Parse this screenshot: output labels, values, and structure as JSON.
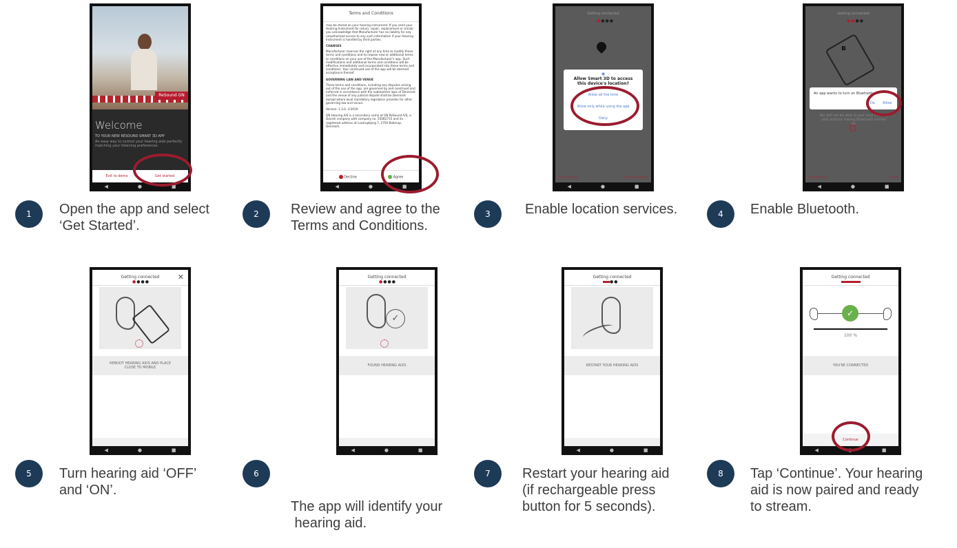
{
  "steps": [
    {
      "number": "1",
      "caption_lines": [
        "Open the app and select",
        "‘Get Started’."
      ]
    },
    {
      "number": "2",
      "caption_lines": [
        "Review and agree to the",
        "Terms and Conditions."
      ]
    },
    {
      "number": "3",
      "caption_lines": [
        "Enable location services."
      ]
    },
    {
      "number": "4",
      "caption_lines": [
        "Enable Bluetooth."
      ]
    },
    {
      "number": "5",
      "caption_lines": [
        "Turn hearing aid ‘OFF’",
        "and ‘ON’."
      ]
    },
    {
      "number": "6",
      "caption_lines": [
        "The app will identify your",
        " hearing aid."
      ]
    },
    {
      "number": "7",
      "caption_lines": [
        "Restart your hearing aid",
        "(if rechargeable press",
        "button for 5 seconds)."
      ]
    },
    {
      "number": "8",
      "caption_lines": [
        "Tap ‘Continue’. Your hearing",
        "aid is now paired and ready",
        "to stream."
      ]
    }
  ],
  "screen1": {
    "welcome": "Welcome",
    "brand": "ReSound GN",
    "subtitle": "TO YOUR NEW RESOUND SMART 3D APP",
    "description": "An easy way to control your hearing aids perfectly matching your listening preferences.",
    "exit_label": "Exit to demo",
    "start_label": "Get started"
  },
  "screen2": {
    "title": "Terms and Conditions",
    "para1": "may be stored on your hearing instrument. If you send your Hearing Instrument for return, repair, replacement or similar you acknowledge that Manufacturer has no liability for any unauthorized access to any such information if your Hearing Instrument is handled by third parties.",
    "heading_changes": "CHANGES",
    "para2": "Manufacturer reserves the right at any time to modify these terms and conditions and to impose new or additional terms or conditions on your use of the Manufacturer's app. Such modifications and additional terms and conditions will be effective immediately and incorporated into these terms and conditions. Your continued use of the app will be deemed acceptance thereof.",
    "heading_law": "GOVERNING LAW AND VENUE",
    "para3": "These terms and conditions, including any disputes arising out of the use of the app, are governed by and construed and enforced in accordance with the substantive laws of Denmark and the venue of any judicial dispute shall be Denmark except where local mandatory legislation provides for other governing law and venue.",
    "version": "Version: 1.3.0, ©2019",
    "para4": "GN Hearing A/S is a secondary name of GN ReSound A/S, a Danish company with company no. 55082715 and its registered address at Lautrupbjerg 7, 2750 Ballerup, Denmark.",
    "decline_label": "Decline",
    "agree_label": "Agree"
  },
  "screen3": {
    "header": "Getting connected",
    "question": "Allow Smart 3D to access this device's location?",
    "option1": "Allow all the time",
    "option2": "Allow only while using the app",
    "option3": "Deny",
    "bottom_left": "Exit pairing",
    "bottom_right": "Go to settings"
  },
  "screen4": {
    "header": "Getting connected",
    "prompt": "An app wants to turn on Bluetooth",
    "deny_label": "De",
    "allow_label": "Allow",
    "warning": "We will not be able to pair your hearing aids without having Bluetooth turned on",
    "bottom_left": "Exit pairing",
    "bottom_right": "Allow"
  },
  "screen5": {
    "header": "Getting connected",
    "message_line1": "REBOOT HEARING AIDS AND PLACE",
    "message_line2": "CLOSE TO MOBILE"
  },
  "screen6": {
    "header": "Getting connected",
    "message": "FOUND HEARING AIDS"
  },
  "screen7": {
    "header": "Getting connected",
    "message": "RESTART YOUR HEARING AIDS"
  },
  "screen8": {
    "header": "Getting connected",
    "percent": "100 %",
    "message": "YOU'RE CONNECTED",
    "continue_label": "Continue"
  },
  "colors": {
    "badge": "#1d3a57",
    "highlight_ring": "#9b1c2e",
    "accent_red": "#b71c2e",
    "agree_green": "#6ab04c"
  }
}
